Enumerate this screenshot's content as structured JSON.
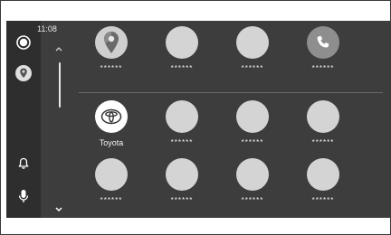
{
  "status": {
    "time": "11:08"
  },
  "rail": {
    "items": [
      {
        "icon": "home-circle-icon"
      },
      {
        "icon": "map-pin-icon"
      },
      {
        "icon": "bell-icon"
      },
      {
        "icon": "microphone-icon"
      }
    ]
  },
  "grid": {
    "rows": [
      [
        {
          "label": "******",
          "icon": "maps-pin-icon"
        },
        {
          "label": "******",
          "icon": "blank-app-icon"
        },
        {
          "label": "******",
          "icon": "blank-app-icon"
        },
        {
          "label": "******",
          "icon": "phone-icon"
        }
      ],
      [
        {
          "label": "Toyota",
          "icon": "toyota-logo-icon"
        },
        {
          "label": "******",
          "icon": "blank-app-icon"
        },
        {
          "label": "******",
          "icon": "blank-app-icon"
        },
        {
          "label": "******",
          "icon": "blank-app-icon"
        }
      ],
      [
        {
          "label": "******",
          "icon": "blank-app-icon"
        },
        {
          "label": "******",
          "icon": "blank-app-icon"
        },
        {
          "label": "******",
          "icon": "blank-app-icon"
        },
        {
          "label": "******",
          "icon": "blank-app-icon"
        }
      ]
    ]
  },
  "colors": {
    "screen": "#3d3d3d",
    "rail": "#2e2e2e",
    "icon_bg": "#d4d4d4",
    "text": "#f2f2f2"
  }
}
